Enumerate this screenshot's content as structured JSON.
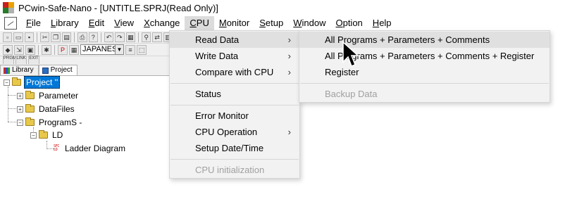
{
  "window": {
    "title": "PCwin-Safe-Nano - [UNTITLE.SPRJ(Read Only)]"
  },
  "menubar": [
    {
      "accel": "F",
      "rest": "ile"
    },
    {
      "accel": "L",
      "rest": "ibrary"
    },
    {
      "accel": "E",
      "rest": "dit"
    },
    {
      "accel": "V",
      "rest": "iew"
    },
    {
      "accel": "X",
      "rest": "change"
    },
    {
      "accel": "C",
      "rest": "PU"
    },
    {
      "accel": "M",
      "rest": "onitor"
    },
    {
      "accel": "S",
      "rest": "etup"
    },
    {
      "accel": "W",
      "rest": "indow"
    },
    {
      "accel": "O",
      "rest": "ption"
    },
    {
      "accel": "H",
      "rest": "elp"
    }
  ],
  "toolbar": {
    "language_select": "JAPANES",
    "small_labels": [
      "PRGM",
      "LINK",
      "EXIT"
    ]
  },
  "tabs": [
    {
      "label": "Library"
    },
    {
      "label": "Project"
    }
  ],
  "tree": {
    "root": "Project ''",
    "parameter": "Parameter",
    "datafiles": "DataFiles",
    "programs": "ProgramS -",
    "ld": "LD",
    "ladder": "Ladder Diagram"
  },
  "cpu_menu": {
    "read_data": "Read Data",
    "write_data": "Write Data",
    "compare": "Compare with CPU",
    "status": "Status",
    "error_monitor": "Error Monitor",
    "cpu_operation": "CPU Operation",
    "setup_datetime": "Setup Date/Time",
    "cpu_init": "CPU initialization",
    "submenu_arrow": "›"
  },
  "read_submenu": {
    "item1": "All Programs + Parameters + Comments",
    "item2": "All Programs + Parameters + Comments + Register",
    "item3": "Register",
    "item4": "Backup Data"
  },
  "colors": {
    "selection": "#0078d7",
    "menu_bg": "#f2f2f2",
    "menu_highlight": "#e0e0e0",
    "disabled_text": "#a0a0a0"
  }
}
